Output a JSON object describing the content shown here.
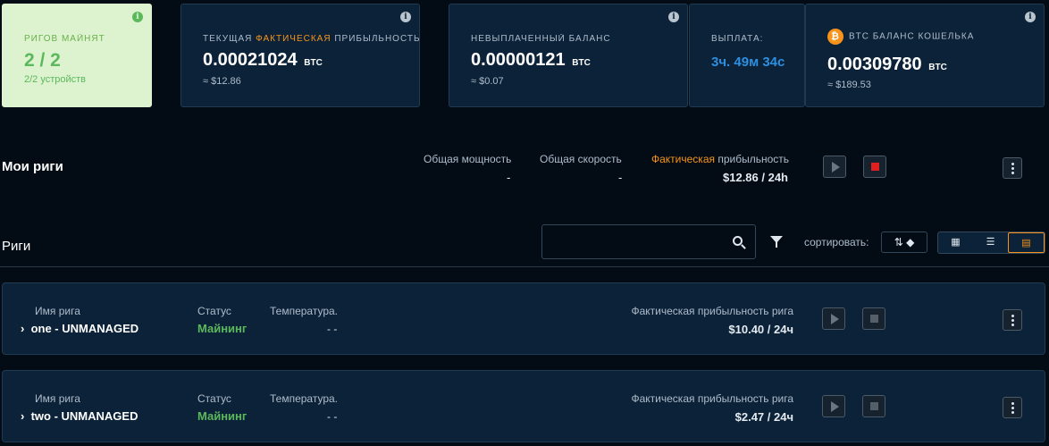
{
  "cards": {
    "rigs": {
      "label": "РИГОВ МАЙНЯТ",
      "value": "2 / 2",
      "sub": "2/2 устройств"
    },
    "profit": {
      "label_pre": "ТЕКУЩАЯ ",
      "label_hl": "ФАКТИЧЕСКАЯ",
      "label_post": " ПРИБЫЛЬНОСТЬ",
      "value": "0.00021024",
      "unit": "BTC",
      "sub": "≈ $12.86"
    },
    "unpaid": {
      "label": "НЕВЫПЛАЧЕННЫЙ БАЛАНС",
      "value": "0.00000121",
      "unit": "BTC",
      "sub": "≈ $0.07"
    },
    "payout": {
      "label": "ВЫПЛАТА:",
      "value": "3ч. 49м 34с"
    },
    "wallet": {
      "label": "BTC БАЛАНС КОШЕЛЬКА",
      "icon_glyph": "₿",
      "value": "0.00309780",
      "unit": "BTC",
      "sub": "≈ $189.53"
    }
  },
  "my_rigs": {
    "title": "Мои риги",
    "power_label": "Общая мощность",
    "power_value": "-",
    "speed_label": "Общая скорость",
    "speed_value": "-",
    "profit_label_hl": "Фактическая",
    "profit_label_rest": " прибыльность",
    "profit_value": "$12.86 / 24h"
  },
  "rigs_section": {
    "title": "Риги",
    "search_placeholder": "",
    "sort_label": "сортировать:",
    "sort_glyph": "⇅ ◆"
  },
  "rigs": [
    {
      "name_label": "Имя рига",
      "name": "one - UNMANAGED",
      "status_label": "Статус",
      "status": "Майнинг",
      "temp_label": "Температура.",
      "temp": "- -",
      "profit_label": "Фактическая прибыльность рига",
      "profit": "$10.40 / 24ч"
    },
    {
      "name_label": "Имя рига",
      "name": "two - UNMANAGED",
      "status_label": "Статус",
      "status": "Майнинг",
      "temp_label": "Температура.",
      "temp": "- -",
      "profit_label": "Фактическая прибыльность рига",
      "profit": "$2.47 / 24ч"
    }
  ],
  "colors": {
    "accent": "#f7931a",
    "green": "#5cb85c",
    "blue": "#2d8fe0",
    "card": "#0c2238",
    "bg": "#030c15"
  }
}
